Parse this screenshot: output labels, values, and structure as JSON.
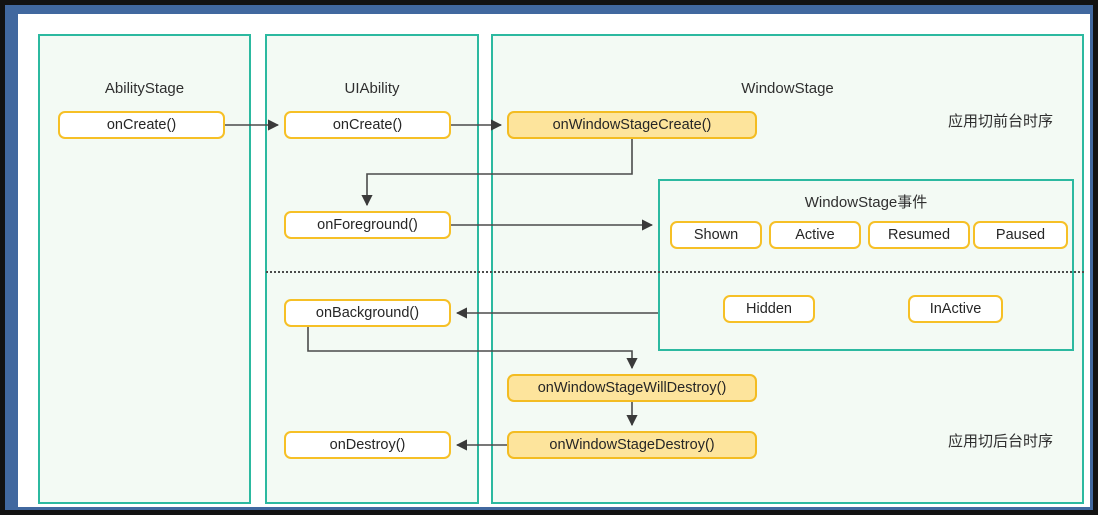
{
  "diagram": {
    "title": "UIAbility and WindowStage lifecycle sequence",
    "colors": {
      "panel_border": "#2cb9a0",
      "panel_fill": "#f3faf4",
      "node_border": "#f6c026",
      "node_fill_plain": "#ffffff",
      "node_fill_highlight": "#fde49c",
      "connector": "#4b4b4b",
      "frame_blue": "#41689f",
      "frame_outer": "#121212"
    }
  },
  "lanes": [
    {
      "id": "abilitystage",
      "title": "AbilityStage"
    },
    {
      "id": "uiability",
      "title": "UIAbility"
    },
    {
      "id": "windowstage",
      "title": "WindowStage"
    }
  ],
  "nodes": {
    "abilitystage_oncreate": "onCreate()",
    "abilitystage_ondestroy": "onDestroy()",
    "uiability_oncreate": "onCreate()",
    "uiability_onforeground": "onForeground()",
    "uiability_onbackground": "onBackground()",
    "windowstage_oncreate": "onWindowStageCreate()",
    "windowstage_onwilldestroy": "onWindowStageWillDestroy()",
    "windowstage_ondestroy": "onWindowStageDestroy()"
  },
  "events_group": {
    "title": "WindowStage事件",
    "chips": {
      "shown": "Shown",
      "active": "Active",
      "resumed": "Resumed",
      "paused": "Paused",
      "hidden": "Hidden",
      "inactive": "InActive"
    }
  },
  "captions": {
    "foreground_phase": "应用切前台时序",
    "background_phase": "应用切后台时序"
  }
}
